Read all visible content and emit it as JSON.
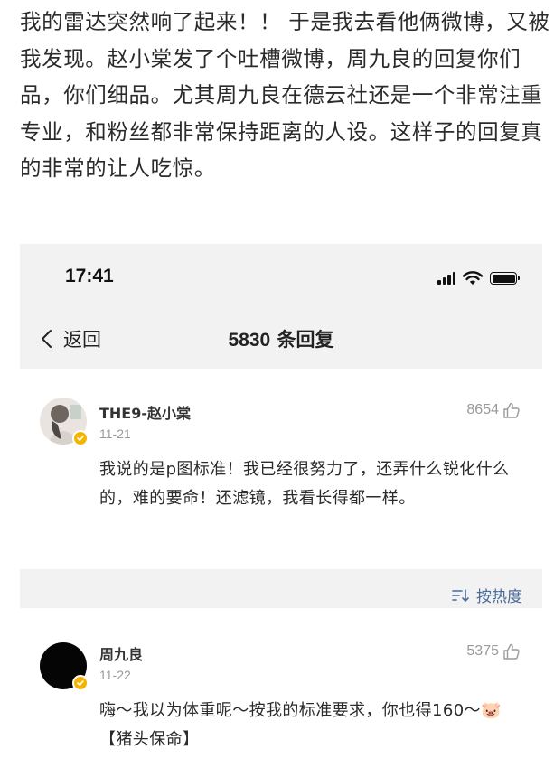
{
  "article": {
    "paragraph": "我的雷达突然响了起来！！ 于是我去看他俩微博，又被我发现。赵小棠发了个吐槽微博，周九良的回复你们品，你们细品。尤其周九良在德云社还是一个非常注重专业，和粉丝都非常保持距离的人设。这样子的回复真的非常的让人吃惊。"
  },
  "phone": {
    "status": {
      "time": "17:41",
      "signal_level": 1.0,
      "battery_level": 1.0
    },
    "nav": {
      "back_label": "返回",
      "title_count": "5830",
      "title_suffix": " 条回复"
    },
    "comments": [
      {
        "user": "THE9-赵小棠",
        "date": "11-21",
        "likes": "8654",
        "text": "我说的是p图标准！我已经很努力了，还弄什么锐化什么的，难的要命！还滤镜，我看长得都一样。"
      },
      {
        "user": "周九良",
        "date": "11-22",
        "likes": "5375",
        "text": "嗨～我以为体重呢～按我的标准要求，你也得160～🐷【猪头保命】"
      }
    ],
    "sort_label": "按热度"
  },
  "colors": {
    "link": "#4a6b9c",
    "verify_badge": "#f4b400",
    "muted": "#9a9a9a"
  }
}
